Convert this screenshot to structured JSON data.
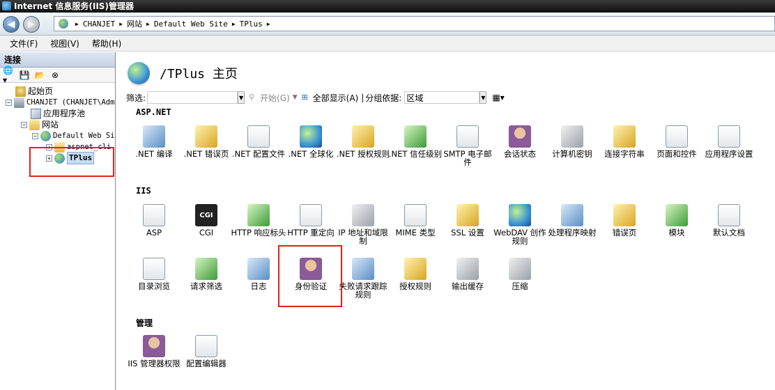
{
  "window": {
    "title": "Internet 信息服务(IIS)管理器"
  },
  "breadcrumb": [
    "CHANJET",
    "网站",
    "Default Web Site",
    "TPlus"
  ],
  "menu": [
    "文件(F)",
    "视图(V)",
    "帮助(H)"
  ],
  "connections": {
    "title": "连接",
    "tree": {
      "start_page": "起始页",
      "server": "CHANJET (CHANJET\\Adm",
      "app_pools": "应用程序池",
      "sites": "网站",
      "default_site": "Default Web Si",
      "aspnet_client": "aspnet_cli",
      "tplus": "TPlus"
    }
  },
  "page": {
    "title": "/TPlus 主页"
  },
  "filterbar": {
    "filter_label": "筛选:",
    "start": "开始(G)",
    "show_all": "全部显示(A)",
    "group_by": "分组依据:",
    "group_value": "区域"
  },
  "sections": {
    "aspnet": {
      "title": "ASP.NET",
      "items": [
        ".NET 编译",
        ".NET 错误页",
        ".NET 配置文件",
        ".NET 全球化",
        ".NET 授权规则",
        ".NET 信任级别",
        "SMTP 电子邮件",
        "会话状态",
        "计算机密钥",
        "连接字符串",
        "页面和控件",
        "应用程序设置"
      ]
    },
    "iis": {
      "title": "IIS",
      "items": [
        "ASP",
        "CGI",
        "HTTP 响应标头",
        "HTTP 重定向",
        "IP 地址和域限制",
        "MIME 类型",
        "SSL 设置",
        "WebDAV 创作规则",
        "处理程序映射",
        "错误页",
        "模块",
        "默认文档",
        "目录浏览",
        "请求筛选",
        "日志",
        "身份验证",
        "失败请求跟踪规则",
        "授权规则",
        "输出缓存",
        "压缩"
      ]
    },
    "manage": {
      "title": "管理",
      "items": [
        "IIS 管理器权限",
        "配置编辑器"
      ]
    }
  }
}
